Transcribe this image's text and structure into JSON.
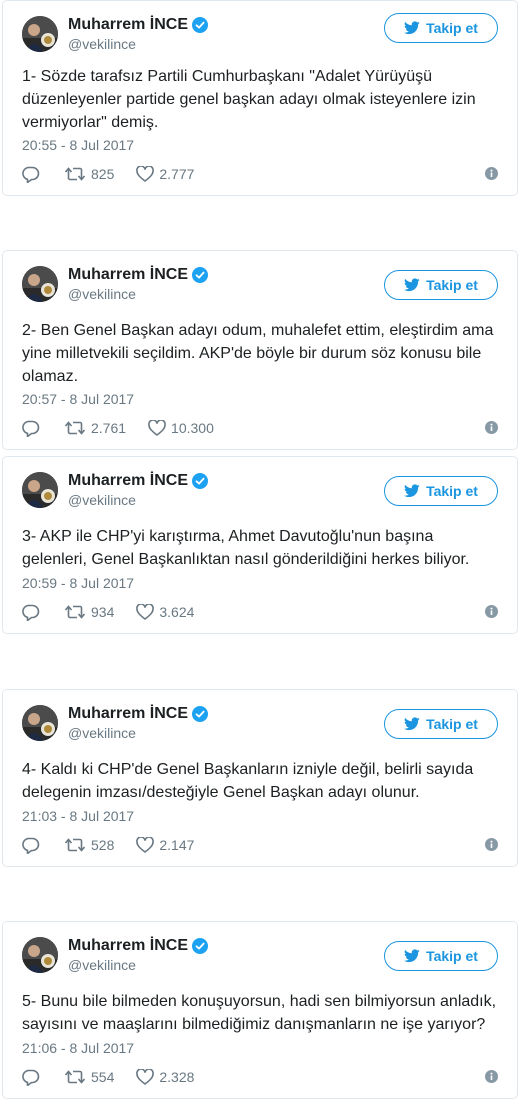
{
  "tweets": [
    {
      "author": "Muharrem İNCE",
      "handle": "@vekilince",
      "follow_label": "Takip et",
      "text": "1- Sözde tarafsız Partili Cumhurbaşkanı \"Adalet Yürüyüşü düzenleyenler partide genel başkan adayı olmak isteyenlere izin vermiyorlar\" demiş.",
      "time": "20:55 - 8 Jul 2017",
      "retweets": "825",
      "likes": "2.777"
    },
    {
      "author": "Muharrem İNCE",
      "handle": "@vekilince",
      "follow_label": "Takip et",
      "text": "2- Ben Genel Başkan adayı odum, muhalefet ettim, eleştirdim ama yine milletvekili seçildim. AKP'de böyle bir durum söz konusu bile olamaz.",
      "time": "20:57 - 8 Jul 2017",
      "retweets": "2.761",
      "likes": "10.300"
    },
    {
      "author": "Muharrem İNCE",
      "handle": "@vekilince",
      "follow_label": "Takip et",
      "text": "3- AKP ile CHP'yi karıştırma, Ahmet Davutoğlu'nun başına gelenleri, Genel Başkanlıktan nasıl gönderildiğini herkes biliyor.",
      "time": "20:59 - 8 Jul 2017",
      "retweets": "934",
      "likes": "3.624"
    },
    {
      "author": "Muharrem İNCE",
      "handle": "@vekilince",
      "follow_label": "Takip et",
      "text": "4- Kaldı ki CHP'de Genel Başkanların izniyle değil, belirli sayıda delegenin imzası/desteğiyle Genel Başkan adayı olunur.",
      "time": "21:03 - 8 Jul 2017",
      "retweets": "528",
      "likes": "2.147"
    },
    {
      "author": "Muharrem İNCE",
      "handle": "@vekilince",
      "follow_label": "Takip et",
      "text": "5- Bunu bile bilmeden konuşuyorsun, hadi sen bilmiyorsun anladık, sayısını ve maaşlarını bilmediğimiz danışmanların ne işe yarıyor?",
      "time": "21:06 - 8 Jul 2017",
      "retweets": "554",
      "likes": "2.328"
    }
  ],
  "icons": {
    "verified": "verified-badge-icon",
    "bird": "twitter-bird-icon",
    "reply": "reply-icon",
    "retweet": "retweet-icon",
    "like": "heart-icon",
    "info": "info-icon"
  },
  "colors": {
    "accent": "#1b95e0",
    "secondary_text": "#697882",
    "border": "#e1e8ed"
  }
}
